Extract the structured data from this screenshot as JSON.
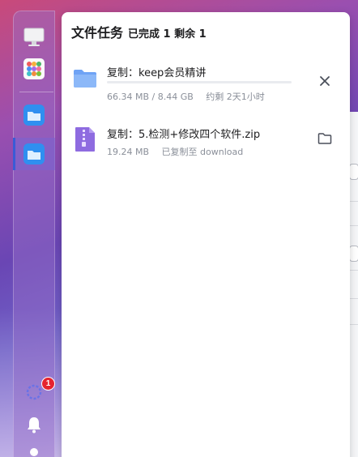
{
  "panel": {
    "title": "文件任务",
    "status": "已完成 1 剩余 1"
  },
  "tasks": [
    {
      "name": "复制：keep会员精讲",
      "icon": "folder-icon",
      "progress": 0.0,
      "size": "66.34 MB / 8.44 GB",
      "eta": "约剩 2天1小时",
      "action_icon": "close-icon"
    },
    {
      "name": "复制：5.检测+修改四个软件.zip",
      "icon": "zip-file-icon",
      "size": "19.24 MB",
      "dest": "已复制至 download",
      "action_icon": "open-folder-icon"
    }
  ],
  "dock": {
    "items": [
      "monitor-icon",
      "apps-grid-icon",
      "file-station-icon",
      "file-station-icon-active",
      "activity-icon",
      "notification-bell-icon",
      "more-icon"
    ],
    "badge_count": "1"
  },
  "colors": {
    "accent": "#4a7cf0",
    "badge": "#e5232f",
    "folder": "#6fa3f5",
    "zip": "#8e6be0"
  }
}
